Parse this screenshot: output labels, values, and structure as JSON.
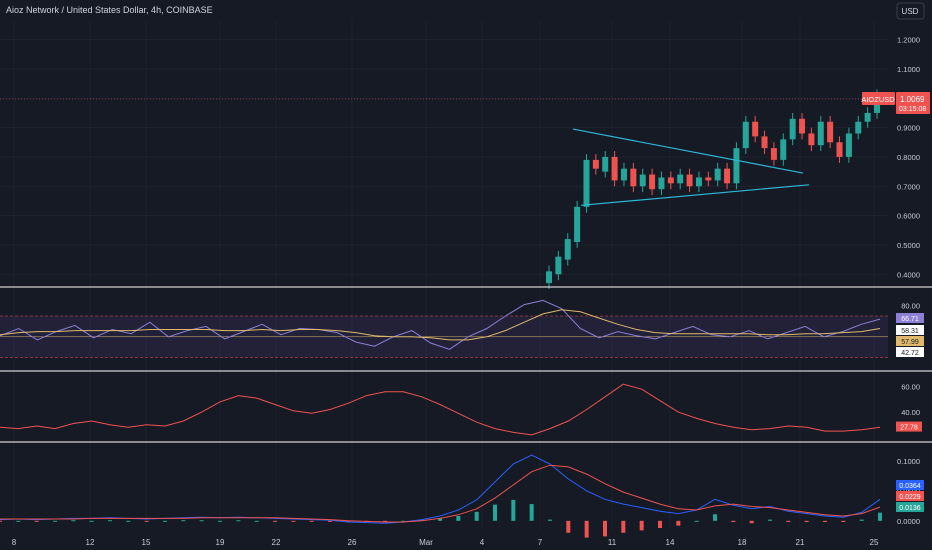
{
  "header": {
    "title": "Aioz Network / United States Dollar, 4h, COINBASE",
    "currency": "USD"
  },
  "price_tag": {
    "symbol": "AIOZUSD",
    "price": "1.0069",
    "countdown": "03:15:08"
  },
  "colors": {
    "bg": "#161a25",
    "grid": "#222633",
    "text": "#d1d4dc",
    "axis_text": "#c9ccd6",
    "up": "#26a69a",
    "down": "#ef5350",
    "trend": "#2fb6d8",
    "rsi_line": "#8e7fd6",
    "rsi_ma": "#e0b96a",
    "adx": "#ef5350",
    "macd": "#2962ff",
    "signal": "#ef5350",
    "separator": "#ffffff"
  },
  "chart_data": [
    {
      "type": "candlestick",
      "title": "Aioz Network / United States Dollar, 4h, COINBASE",
      "x_ticks": [
        "8",
        "12",
        "15",
        "19",
        "22",
        "26",
        "Mar",
        "4",
        "7",
        "11",
        "14",
        "18",
        "21",
        "25"
      ],
      "y_ticks": [
        "1.2000",
        "1.1000",
        "1.0000",
        "0.9000",
        "0.8000",
        "0.7000",
        "0.6000",
        "0.5000",
        "0.4000"
      ],
      "ylim": [
        0.36,
        1.26
      ],
      "series": [
        {
          "name": "AIOZUSD",
          "last": 1.0069
        }
      ],
      "candles_summary": [
        [
          0.37,
          0.41
        ],
        [
          0.4,
          0.46
        ],
        [
          0.45,
          0.52
        ],
        [
          0.51,
          0.63
        ],
        [
          0.63,
          0.79
        ],
        [
          0.79,
          0.76
        ],
        [
          0.75,
          0.8
        ],
        [
          0.8,
          0.72
        ],
        [
          0.72,
          0.76
        ],
        [
          0.76,
          0.7
        ],
        [
          0.7,
          0.74
        ],
        [
          0.74,
          0.69
        ],
        [
          0.69,
          0.73
        ],
        [
          0.73,
          0.71
        ],
        [
          0.71,
          0.74
        ],
        [
          0.74,
          0.7
        ],
        [
          0.7,
          0.73
        ],
        [
          0.73,
          0.72
        ],
        [
          0.72,
          0.76
        ],
        [
          0.76,
          0.71
        ],
        [
          0.71,
          0.83
        ],
        [
          0.83,
          0.92
        ],
        [
          0.92,
          0.87
        ],
        [
          0.87,
          0.83
        ],
        [
          0.83,
          0.79
        ],
        [
          0.79,
          0.86
        ],
        [
          0.86,
          0.93
        ],
        [
          0.93,
          0.88
        ],
        [
          0.88,
          0.84
        ],
        [
          0.84,
          0.92
        ],
        [
          0.92,
          0.85
        ],
        [
          0.85,
          0.8
        ],
        [
          0.8,
          0.88
        ],
        [
          0.88,
          0.92
        ],
        [
          0.92,
          0.95
        ],
        [
          0.95,
          1.01
        ]
      ],
      "trend_lines": [
        {
          "from": [
            "Mar 8",
            0.895
          ],
          "to": [
            "Mar 22",
            0.745
          ]
        },
        {
          "from": [
            "Mar 8",
            0.635
          ],
          "to": [
            "Mar 22",
            0.705
          ]
        }
      ],
      "annotations": [
        "AIOZUSD 1.0069 03:15:08"
      ]
    },
    {
      "type": "line",
      "name": "RSI",
      "y_ticks": [
        "80.00"
      ],
      "ylim": [
        20,
        95
      ],
      "levels": [
        70,
        30
      ],
      "value_labels": [
        "66.71",
        "58.31",
        "57.99",
        "42.72"
      ],
      "series": [
        {
          "name": "rsi",
          "values": [
            51,
            58,
            47,
            55,
            61,
            49,
            57,
            53,
            64,
            50,
            56,
            60,
            48,
            55,
            62,
            52,
            58,
            57,
            54,
            45,
            41,
            50,
            56,
            44,
            38,
            50,
            58,
            70,
            81,
            85,
            77,
            58,
            49,
            55,
            51,
            48,
            54,
            60,
            52,
            50,
            56,
            48,
            54,
            60,
            50,
            55,
            62,
            67
          ]
        },
        {
          "name": "rsi-ma",
          "values": [
            52,
            54,
            55,
            55,
            56,
            56,
            56,
            56,
            57,
            57,
            57,
            57,
            56,
            56,
            57,
            56,
            57,
            57,
            56,
            54,
            51,
            50,
            50,
            49,
            47,
            47,
            50,
            56,
            64,
            72,
            76,
            74,
            68,
            62,
            57,
            54,
            53,
            53,
            53,
            53,
            53,
            52,
            52,
            53,
            53,
            54,
            55,
            58
          ]
        }
      ]
    },
    {
      "type": "line",
      "name": "ADX",
      "y_ticks": [
        "60.00",
        "40.00"
      ],
      "ylim": [
        18,
        70
      ],
      "value_labels": [
        "27.78"
      ],
      "series": [
        {
          "name": "adx",
          "values": [
            28,
            27,
            29,
            27,
            31,
            33,
            30,
            28,
            30,
            29,
            33,
            40,
            48,
            53,
            51,
            46,
            41,
            39,
            42,
            47,
            53,
            56,
            56,
            52,
            46,
            39,
            32,
            27,
            24,
            22,
            27,
            33,
            42,
            52,
            62,
            58,
            49,
            40,
            35,
            31,
            28,
            26,
            27,
            29,
            28,
            25,
            25,
            26,
            28
          ]
        }
      ]
    },
    {
      "type": "bar",
      "name": "MACD",
      "y_ticks": [
        "0.1000",
        "0.0500",
        "0.0000"
      ],
      "ylim": [
        -0.012,
        0.125
      ],
      "value_labels": [
        "0.0364",
        "0.0229",
        "0.0136"
      ],
      "series": [
        {
          "name": "macd",
          "values": [
            0.002,
            0.003,
            0.002,
            0.003,
            0.004,
            0.004,
            0.005,
            0.004,
            0.003,
            0.004,
            0.005,
            0.006,
            0.005,
            0.006,
            0.005,
            0.004,
            0.003,
            0.002,
            0.001,
            -0.002,
            -0.003,
            -0.004,
            -0.002,
            0.002,
            0.008,
            0.018,
            0.035,
            0.065,
            0.095,
            0.11,
            0.095,
            0.07,
            0.05,
            0.036,
            0.028,
            0.022,
            0.016,
            0.012,
            0.018,
            0.036,
            0.026,
            0.02,
            0.024,
            0.016,
            0.012,
            0.008,
            0.006,
            0.014,
            0.036
          ]
        },
        {
          "name": "signal",
          "values": [
            0.003,
            0.003,
            0.003,
            0.003,
            0.003,
            0.004,
            0.004,
            0.004,
            0.004,
            0.004,
            0.004,
            0.005,
            0.005,
            0.005,
            0.005,
            0.005,
            0.004,
            0.003,
            0.002,
            0.0,
            -0.001,
            -0.002,
            -0.002,
            0.0,
            0.004,
            0.01,
            0.02,
            0.038,
            0.06,
            0.082,
            0.093,
            0.09,
            0.078,
            0.062,
            0.048,
            0.038,
            0.028,
            0.02,
            0.018,
            0.025,
            0.028,
            0.024,
            0.022,
            0.018,
            0.014,
            0.01,
            0.008,
            0.012,
            0.023
          ]
        },
        {
          "name": "histogram",
          "values": [
            -0.001,
            0.0,
            -0.001,
            0.0,
            0.001,
            0.0,
            0.001,
            0.0,
            -0.001,
            0.0,
            0.001,
            0.001,
            0.0,
            0.001,
            0.0,
            -0.001,
            -0.001,
            -0.001,
            -0.001,
            -0.002,
            -0.002,
            -0.002,
            0.0,
            0.002,
            0.004,
            0.008,
            0.015,
            0.027,
            0.035,
            0.028,
            0.002,
            -0.02,
            -0.028,
            -0.026,
            -0.02,
            -0.016,
            -0.012,
            -0.008,
            0.0,
            0.011,
            -0.002,
            -0.004,
            0.002,
            -0.002,
            -0.002,
            -0.002,
            -0.002,
            0.002,
            0.0136
          ]
        }
      ]
    }
  ]
}
